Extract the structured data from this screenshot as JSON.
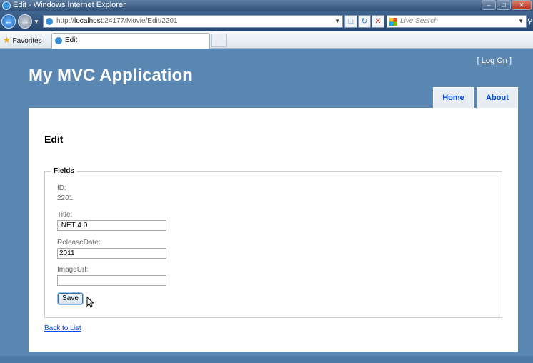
{
  "window": {
    "title": "Edit - Windows Internet Explorer"
  },
  "addressbar": {
    "url_prefix": "http://",
    "url_host": "localhost",
    "url_rest": ":24177/Movie/Edit/2201",
    "search_placeholder": "Live Search"
  },
  "favbar": {
    "favorites_label": "Favorites",
    "tab_label": "Edit"
  },
  "header": {
    "login_open": "[",
    "login_label": "Log On",
    "login_close": "]",
    "app_title": "My MVC Application",
    "menu": [
      "Home",
      "About"
    ]
  },
  "main": {
    "heading": "Edit",
    "fieldset_legend": "Fields",
    "id_label": "ID:",
    "id_value": "2201",
    "title_label": "Title:",
    "title_value": ".NET 4.0",
    "release_label": "ReleaseDate:",
    "release_value": "2011",
    "image_label": "ImageUrl:",
    "image_value": "",
    "save_label": "Save",
    "back_link": "Back to List"
  }
}
